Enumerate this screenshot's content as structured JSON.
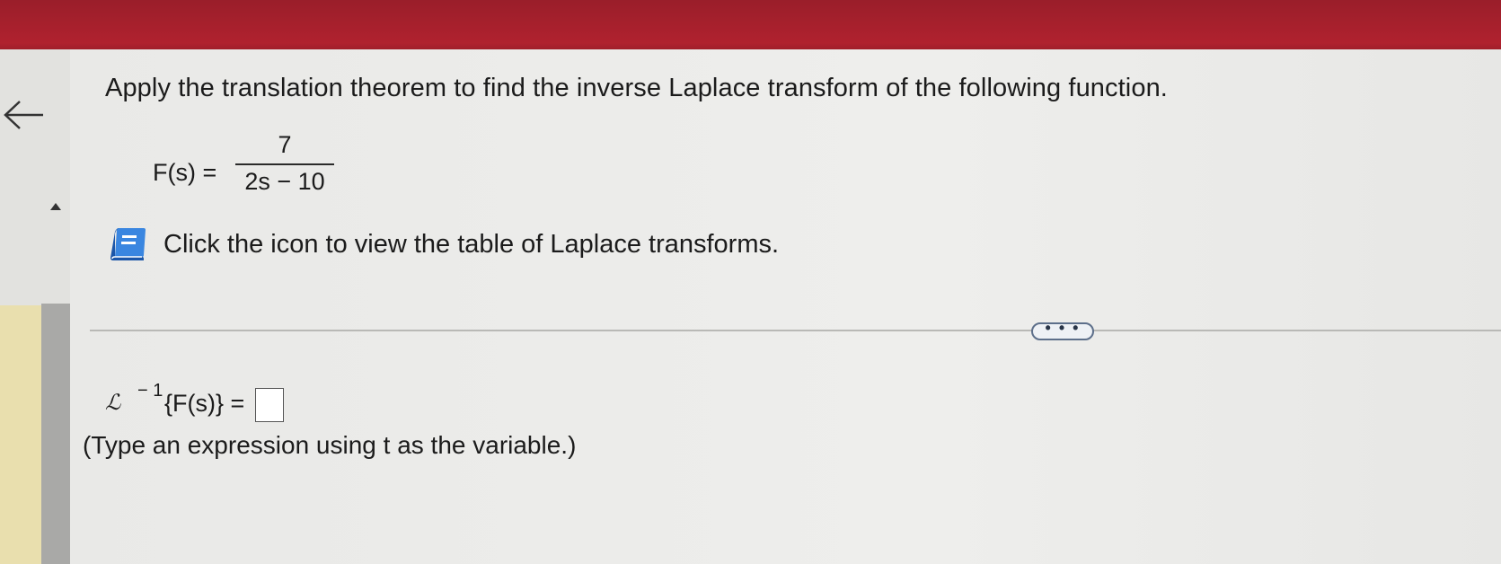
{
  "question": {
    "text": "Apply the translation theorem to find the inverse Laplace transform of the following function."
  },
  "formula": {
    "lhs": "F(s) =",
    "numerator": "7",
    "denominator": "2s − 10"
  },
  "hint": {
    "icon": "book-icon",
    "text": "Click the icon to view the table of Laplace transforms."
  },
  "more_button": {
    "label": "• • •"
  },
  "answer": {
    "operator": "ℒ",
    "superscript": "− 1",
    "lhs": "{F(s)} =",
    "value": ""
  },
  "instruction": {
    "text": "(Type an expression using t as the variable.)"
  },
  "colors": {
    "top_bar": "#a8202d",
    "book_icon": "#2a6fc9",
    "more_button_border": "#5d6f8a"
  }
}
